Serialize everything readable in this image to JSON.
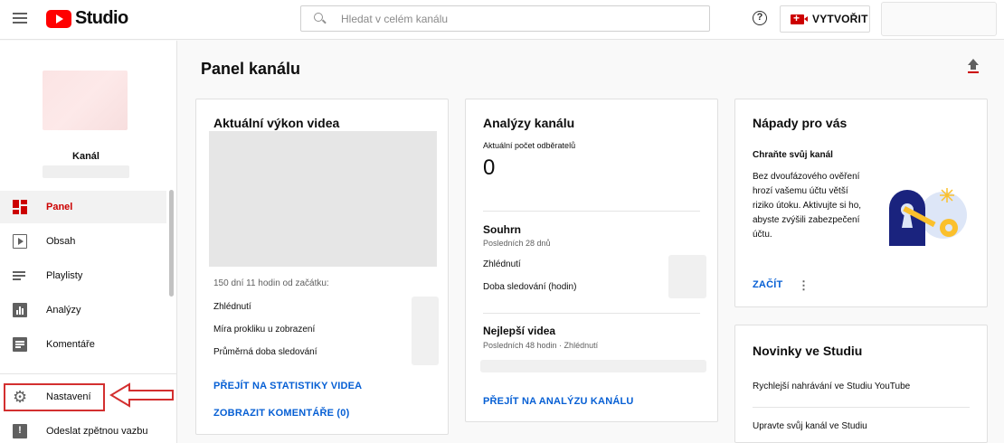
{
  "header": {
    "logo_text": "Studio",
    "search_placeholder": "Hledat v celém kanálu",
    "help_glyph": "?",
    "create_label": "VYTVOŘIT"
  },
  "sidebar": {
    "channel_label": "Kanál",
    "items": [
      {
        "label": "Panel",
        "icon": "dashboard-icon",
        "active": true
      },
      {
        "label": "Obsah",
        "icon": "content-icon"
      },
      {
        "label": "Playlisty",
        "icon": "playlist-icon"
      },
      {
        "label": "Analýzy",
        "icon": "analytics-icon"
      },
      {
        "label": "Komentáře",
        "icon": "comments-icon"
      },
      {
        "label": "Nastavení",
        "icon": "gear-icon",
        "highlighted": true
      },
      {
        "label": "Odeslat zpětnou vazbu",
        "icon": "feedback-icon"
      }
    ]
  },
  "main": {
    "title": "Panel kanálu",
    "video_card": {
      "title": "Aktuální výkon videa",
      "period": "150 dní 11 hodin od začátku:",
      "metrics": [
        "Zhlédnutí",
        "Míra prokliku u zobrazení",
        "Průměrná doba sledování"
      ],
      "link_stats": "PŘEJÍT NA STATISTIKY VIDEA",
      "link_comments": "ZOBRAZIT KOMENTÁŘE (0)"
    },
    "analytics_card": {
      "title": "Analýzy kanálu",
      "subscribers_label": "Aktuální počet odběratelů",
      "subscribers_value": "0",
      "summary_title": "Souhrn",
      "summary_period": "Posledních 28 dnů",
      "summary_rows": [
        "Zhlédnutí",
        "Doba sledování (hodin)"
      ],
      "top_videos_title": "Nejlepší videa",
      "top_videos_period": "Posledních 48 hodin · Zhlédnutí",
      "link": "PŘEJÍT NA ANALÝZU KANÁLU"
    },
    "ideas_card": {
      "title": "Nápady pro vás",
      "subtitle": "Chraňte svůj kanál",
      "body": "Bez dvoufázového ověření hrozí vašemu účtu větší riziko útoku. Aktivujte si ho, abyste zvýšili zabezpečení účtu.",
      "cta": "ZAČÍT",
      "more_glyph": "⋮"
    },
    "news_card": {
      "title": "Novinky ve Studiu",
      "items": [
        "Rychlejší nahrávání ve Studiu YouTube",
        "Upravte svůj kanál ve Studiu"
      ]
    }
  },
  "colors": {
    "brand_red": "#ff0000",
    "active_red": "#cc0000",
    "link_blue": "#065fd4",
    "annotation_red": "#d32f2f"
  }
}
